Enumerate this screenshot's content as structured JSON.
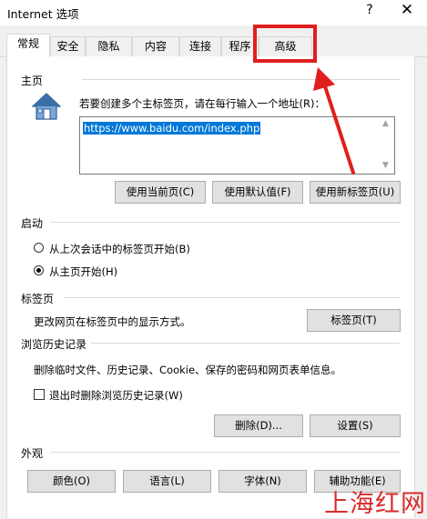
{
  "window": {
    "title": "Internet 选项",
    "help_label": "?",
    "close_label": "✕"
  },
  "tabs": [
    {
      "label": "常规"
    },
    {
      "label": "安全"
    },
    {
      "label": "隐私"
    },
    {
      "label": "内容"
    },
    {
      "label": "连接"
    },
    {
      "label": "程序"
    },
    {
      "label": "高级"
    }
  ],
  "active_tab": "常规",
  "home": {
    "title": "主页",
    "instruction": "若要创建多个主标签页，请在每行输入一个地址(R)：",
    "url": "https://www.baidu.com/index.php",
    "icon": "house-icon",
    "buttons": {
      "use_current": "使用当前页(C)",
      "use_default": "使用默认值(F)",
      "use_new_tab": "使用新标签页(U)"
    }
  },
  "startup": {
    "title": "启动",
    "options": [
      {
        "label": "从上次会话中的标签页开始(B)",
        "selected": false
      },
      {
        "label": "从主页开始(H)",
        "selected": true
      }
    ]
  },
  "tabs_section": {
    "title": "标签页",
    "description": "更改网页在标签页中的显示方式。",
    "button": "标签页(T)"
  },
  "history": {
    "title": "浏览历史记录",
    "description": "删除临时文件、历史记录、Cookie、保存的密码和网页表单信息。",
    "checkbox_label": "退出时删除浏览历史记录(W)",
    "checkbox_checked": false,
    "delete_button": "删除(D)...",
    "settings_button": "设置(S)"
  },
  "appearance": {
    "title": "外观",
    "buttons": {
      "colors": "颜色(O)",
      "languages": "语言(L)",
      "fonts": "字体(N)",
      "accessibility": "辅助功能(E)"
    }
  },
  "annotation": {
    "color": "#e01e1e",
    "highlighted_tab": "高级"
  },
  "watermark": "上海红网"
}
